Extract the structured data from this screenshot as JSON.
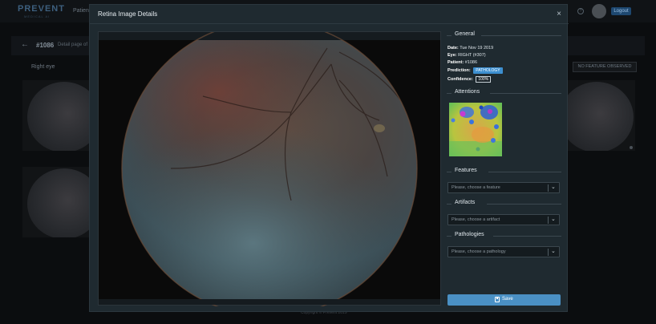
{
  "background": {
    "brand": "PREVENT",
    "brand_sub": "MEDICAL AI",
    "nav_item": "Patients",
    "help_icon": "?",
    "logout_label": "Logout",
    "back_icon": "←",
    "patient_id": "#1086",
    "detail_text": "Detail page of a",
    "right_eye_label": "Right eye",
    "no_feature_label": "NO FEATURE OBSERVED",
    "copyright": "Copyright © Prevent 2019"
  },
  "modal": {
    "title": "Retina Image Details",
    "close_icon": "×",
    "general": {
      "heading": "General",
      "date_label": "Date:",
      "date_value": "Tue Nov 19 2019",
      "eye_label": "Eye:",
      "eye_value": "RIGHT (#307)",
      "patient_label": "Patient:",
      "patient_value": "#1086",
      "prediction_label": "Prediction:",
      "prediction_value": "PATHOLOGY",
      "confidence_label": "Confidence:",
      "confidence_value": "100%"
    },
    "attentions": {
      "heading": "Attentions"
    },
    "features": {
      "heading": "Features",
      "placeholder": "Please, choose a feature"
    },
    "artifacts": {
      "heading": "Artifacts",
      "placeholder": "Please, choose a artifact"
    },
    "pathologies": {
      "heading": "Pathologies",
      "placeholder": "Please, choose a pathology"
    },
    "chevron_icon": "⌄",
    "save_label": "Save"
  },
  "colors": {
    "accent": "#4a90c4",
    "badge": "#3d8fd0",
    "modal_bg": "#1f2a30"
  }
}
